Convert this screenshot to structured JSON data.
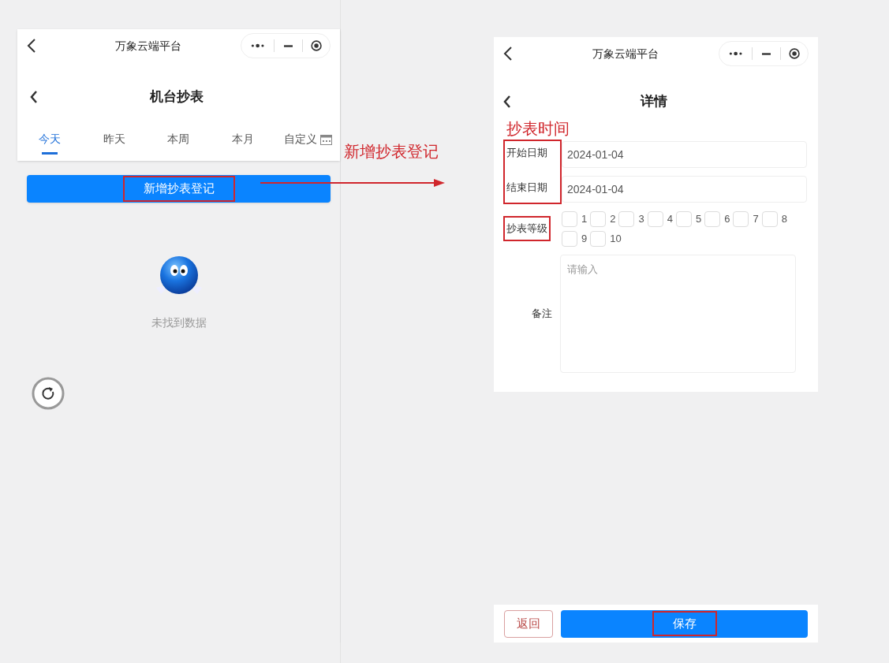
{
  "left_screen": {
    "mini_bar": {
      "title": "万象云端平台"
    },
    "page_title": "机台抄表",
    "tabs": [
      {
        "label": "今天",
        "selected": true,
        "kind": "text"
      },
      {
        "label": "昨天",
        "selected": false,
        "kind": "text"
      },
      {
        "label": "本周",
        "selected": false,
        "kind": "text"
      },
      {
        "label": "本月",
        "selected": false,
        "kind": "text"
      },
      {
        "label": "自定义",
        "selected": false,
        "kind": "calendar"
      }
    ],
    "add_button": {
      "label": "新增抄表登记",
      "highlighted": true
    },
    "empty_text": "未找到数据"
  },
  "annotation": {
    "label": "新增抄表登记"
  },
  "right_screen": {
    "mini_bar": {
      "title": "万象云端平台"
    },
    "page_title": "详情",
    "section_note": "抄表时间",
    "dates": {
      "highlighted": true,
      "fields": [
        {
          "label": "开始日期",
          "value": "2024-01-04"
        },
        {
          "label": "结束日期",
          "value": "2024-01-04"
        }
      ]
    },
    "level": {
      "label": "抄表等级",
      "highlighted": true,
      "options": [
        {
          "label": "1",
          "checked": false
        },
        {
          "label": "2",
          "checked": false
        },
        {
          "label": "3",
          "checked": false
        },
        {
          "label": "4",
          "checked": false
        },
        {
          "label": "5",
          "checked": false
        },
        {
          "label": "6",
          "checked": false
        },
        {
          "label": "7",
          "checked": false
        },
        {
          "label": "8",
          "checked": false
        },
        {
          "label": "9",
          "checked": false
        },
        {
          "label": "10",
          "checked": false
        }
      ]
    },
    "remark": {
      "label": "备注",
      "placeholder": "请输入"
    },
    "buttons": [
      {
        "label": "返回",
        "kind": "outline",
        "highlighted": false
      },
      {
        "label": "保存",
        "kind": "primary",
        "highlighted": true
      }
    ]
  }
}
